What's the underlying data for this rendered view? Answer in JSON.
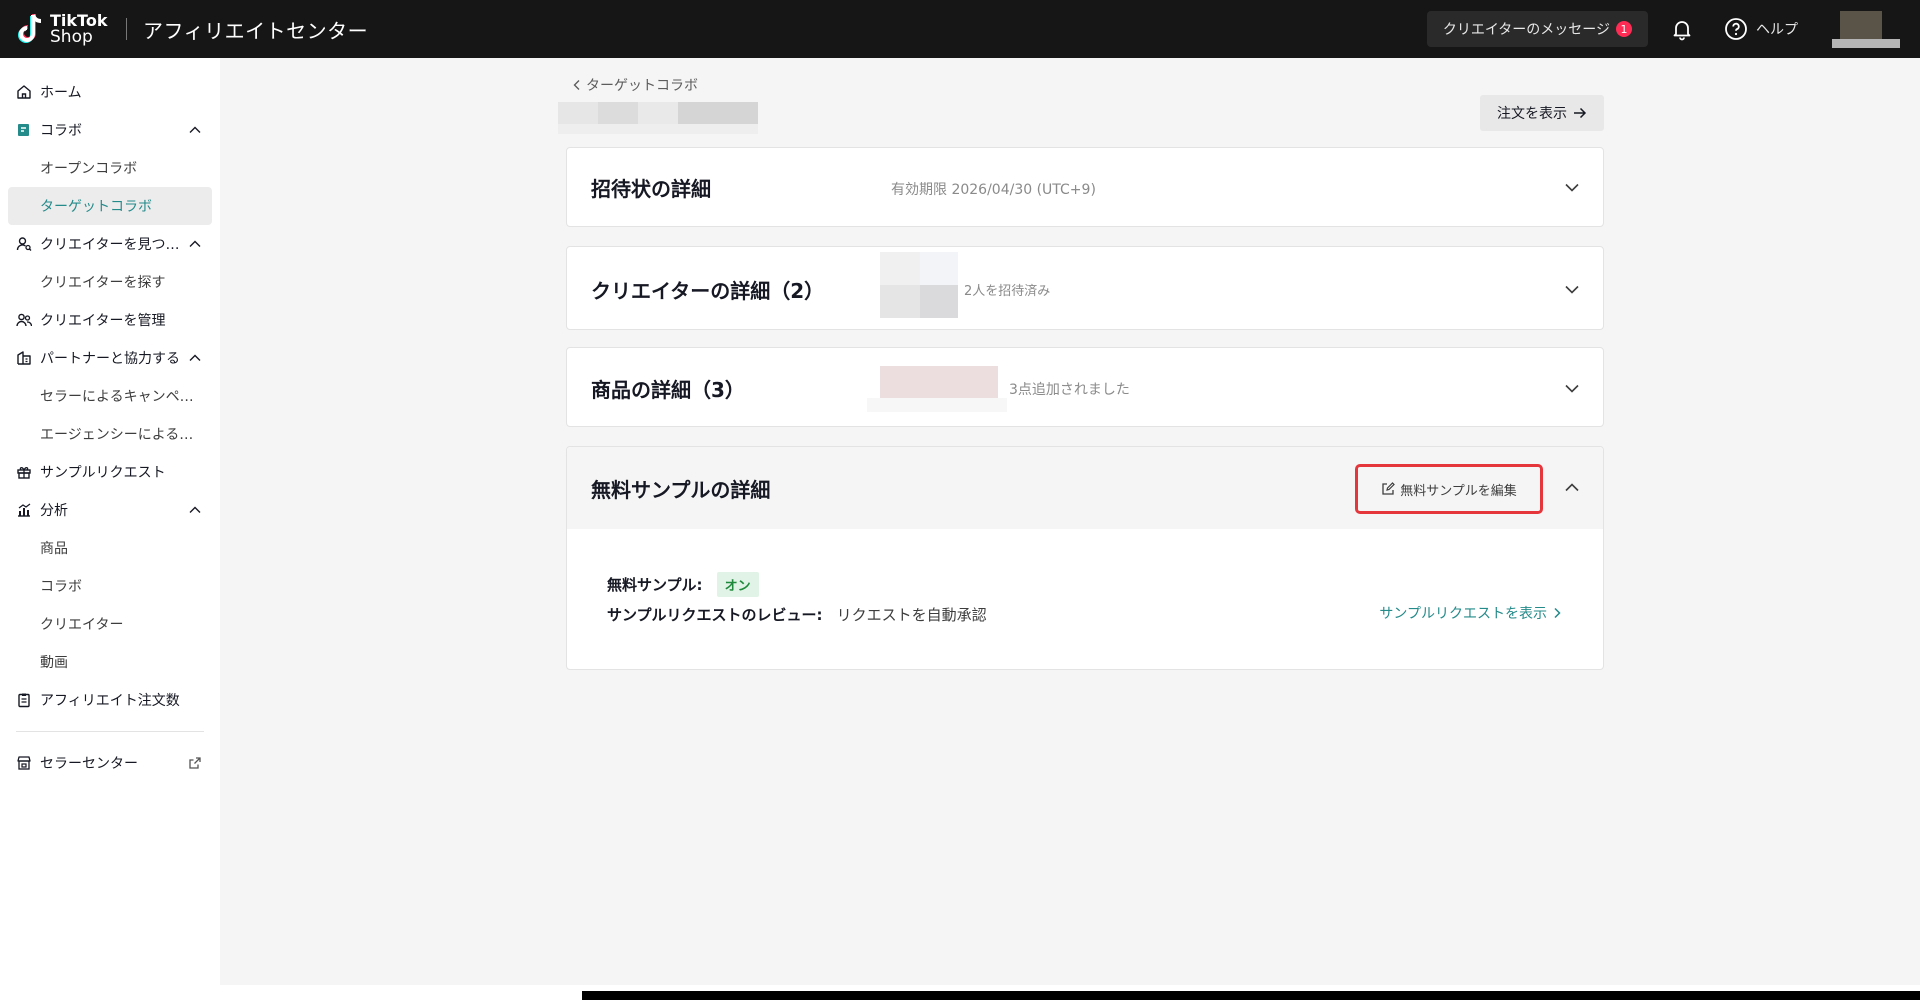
{
  "header": {
    "logo_line1": "TikTok",
    "logo_line2": "Shop",
    "app_title": "アフィリエイトセンター",
    "messages_label": "クリエイターのメッセージ",
    "messages_badge": "1",
    "help_label": "ヘルプ"
  },
  "sidebar": {
    "home": "ホーム",
    "collab": "コラボ",
    "open_collab": "オープンコラボ",
    "target_collab": "ターゲットコラボ",
    "find_creators": "クリエイターを見つ…",
    "search_creators": "クリエイターを探す",
    "manage_creators": "クリエイターを管理",
    "partner": "パートナーと協力する",
    "seller_campaign": "セラーによるキャンペ…",
    "agency": "エージェンシーによる…",
    "sample_request": "サンプルリクエスト",
    "analytics": "分析",
    "products": "商品",
    "collab2": "コラボ",
    "creators": "クリエイター",
    "videos": "動画",
    "affiliate_orders": "アフィリエイト注文数",
    "seller_center": "セラーセンター"
  },
  "main": {
    "breadcrumb": "ターゲットコラボ",
    "view_orders": "注文を表示",
    "invite": {
      "title": "招待状の詳細",
      "expiry": "有効期限 2026/04/30 (UTC+9)"
    },
    "creators": {
      "title": "クリエイターの詳細（2）",
      "summary": "2人を招待済み"
    },
    "products": {
      "title": "商品の詳細（3）",
      "summary": "3点追加されました"
    },
    "samples": {
      "title": "無料サンプルの詳細",
      "edit_label": "無料サンプルを編集",
      "free_sample_label": "無料サンプル:",
      "free_sample_status": "オン",
      "review_label": "サンプルリクエストのレビュー:",
      "review_value": "リクエストを自動承認",
      "view_requests": "サンプルリクエストを表示"
    }
  },
  "colors": {
    "accent": "#258a8a",
    "highlight": "#e5363c",
    "status_on_bg": "#e1f3e6"
  }
}
